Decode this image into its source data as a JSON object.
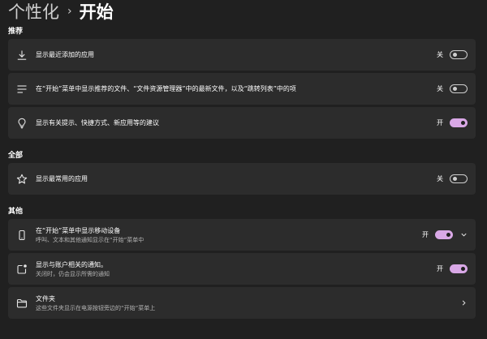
{
  "breadcrumb": {
    "parent": "个性化",
    "separator": "›",
    "current": "开始"
  },
  "sections": {
    "recommended": "推荐",
    "all": "全部",
    "other": "其他"
  },
  "settings": {
    "recent_apps": {
      "label": "显示最近添加的应用",
      "state": "关",
      "on": false,
      "icon": "download-icon"
    },
    "recommended_files": {
      "label": "在“开始”菜单中显示推荐的文件、“文件资源管理器”中的最新文件，以及“跳转列表”中的项",
      "state": "关",
      "on": false,
      "icon": "list-icon"
    },
    "tips": {
      "label": "显示有关提示、快捷方式、新应用等的建议",
      "state": "开",
      "on": true,
      "icon": "lightbulb-icon"
    },
    "most_used": {
      "label": "显示最常用的应用",
      "state": "关",
      "on": false,
      "icon": "star-icon"
    },
    "mobile_device": {
      "label": "在“开始”菜单中显示移动设备",
      "sublabel": "呼叫、文本和其他通知显示在“开始”菜单中",
      "state": "开",
      "on": true,
      "icon": "phone-icon"
    },
    "account_notifications": {
      "label": "显示与账户相关的通知。",
      "sublabel": "关闭时，仍会显示所需的通知",
      "state": "开",
      "on": true,
      "icon": "notification-icon"
    },
    "folders": {
      "label": "文件夹",
      "sublabel": "这些文件夹显示在电源按钮旁边的“开始”菜单上",
      "icon": "folder-icon"
    }
  },
  "colors": {
    "background": "#202020",
    "card": "#2c2c2c",
    "accent": "#d9a8e6"
  }
}
